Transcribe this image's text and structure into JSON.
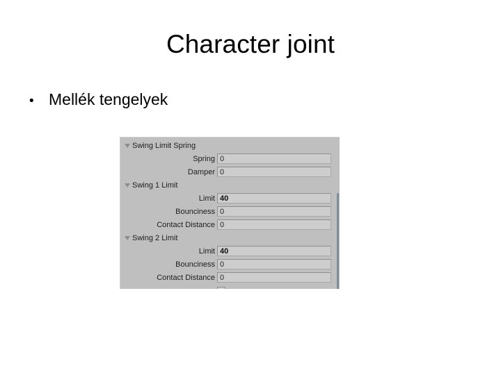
{
  "slide": {
    "title": "Character joint",
    "bullets": [
      {
        "marker": "•",
        "text": "Mellék tengelyek"
      }
    ]
  },
  "inspector": {
    "background_color": "#bfbfbf",
    "field_color": "#cdcdcd",
    "scrollbar_color": "#7e8c9e",
    "rows": [
      {
        "kind": "header",
        "label": "Swing Limit Spring",
        "icon": "triangle-down-icon"
      },
      {
        "kind": "prop",
        "label": "Spring",
        "value": "0",
        "emphasis": false
      },
      {
        "kind": "prop",
        "label": "Damper",
        "value": "0",
        "emphasis": false
      },
      {
        "kind": "header",
        "label": "Swing 1 Limit",
        "icon": "triangle-down-icon"
      },
      {
        "kind": "prop",
        "label": "Limit",
        "value": "40",
        "emphasis": true
      },
      {
        "kind": "prop",
        "label": "Bounciness",
        "value": "0",
        "emphasis": false
      },
      {
        "kind": "prop",
        "label": "Contact Distance",
        "value": "0",
        "emphasis": false
      },
      {
        "kind": "header",
        "label": "Swing 2 Limit",
        "icon": "triangle-down-icon"
      },
      {
        "kind": "prop",
        "label": "Limit",
        "value": "40",
        "emphasis": true
      },
      {
        "kind": "prop",
        "label": "Bounciness",
        "value": "0",
        "emphasis": false
      },
      {
        "kind": "prop",
        "label": "Contact Distance",
        "value": "0",
        "emphasis": false
      },
      {
        "kind": "clipped",
        "label": "",
        "value": "",
        "emphasis": false
      }
    ]
  }
}
